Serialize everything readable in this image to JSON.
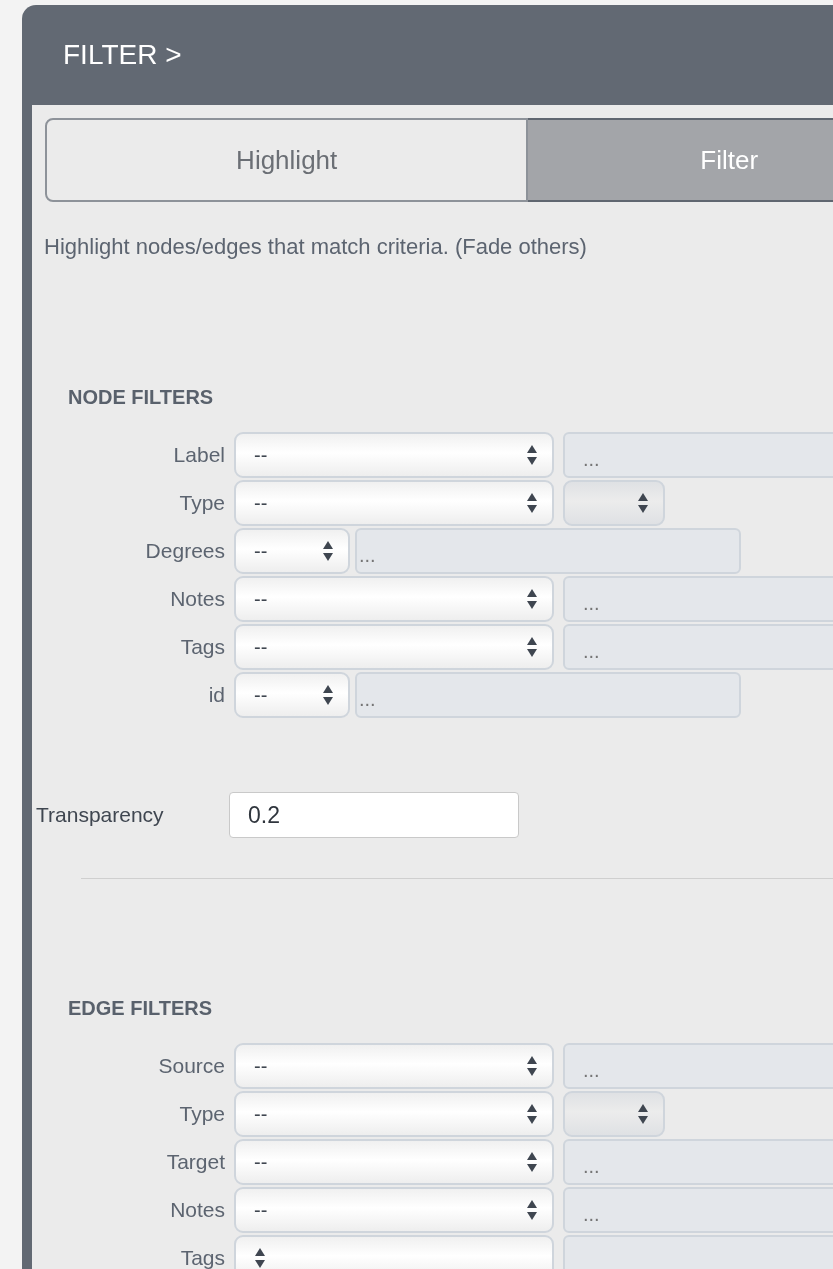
{
  "panel": {
    "title": "FILTER >"
  },
  "tabs": [
    {
      "label": "Highlight",
      "selected": false
    },
    {
      "label": "Filter",
      "selected": true
    }
  ],
  "description": "Highlight nodes/edges that match criteria. (Fade others)",
  "node_filters": {
    "heading": "NODE FILTERS",
    "rows": [
      {
        "kind": "text",
        "label": "Label",
        "operator": "--",
        "placeholder": "..."
      },
      {
        "kind": "type",
        "label": "Type",
        "operator": "--"
      },
      {
        "kind": "short",
        "label": "Degrees",
        "operator": "--",
        "placeholder": "..."
      },
      {
        "kind": "text",
        "label": "Notes",
        "operator": "--",
        "placeholder": "..."
      },
      {
        "kind": "text",
        "label": "Tags",
        "operator": "--",
        "placeholder": "..."
      },
      {
        "kind": "short",
        "label": "id",
        "operator": "--",
        "placeholder": "..."
      }
    ]
  },
  "transparency": {
    "label": "Transparency",
    "value": "0.2"
  },
  "edge_filters": {
    "heading": "EDGE FILTERS",
    "rows": [
      {
        "kind": "text",
        "label": "Source",
        "operator": "--",
        "placeholder": "..."
      },
      {
        "kind": "type",
        "label": "Type",
        "operator": "--"
      },
      {
        "kind": "text",
        "label": "Target",
        "operator": "--",
        "placeholder": "..."
      },
      {
        "kind": "text",
        "label": "Notes",
        "operator": "--",
        "placeholder": "..."
      },
      {
        "kind": "text",
        "label": "Tags"
      }
    ]
  }
}
